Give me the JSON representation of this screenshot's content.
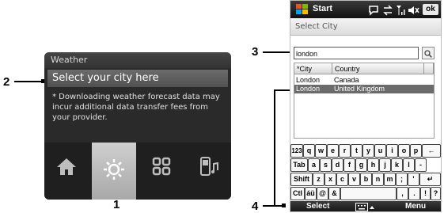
{
  "callouts": {
    "c1": "1",
    "c2": "2",
    "c3": "3",
    "c4": "4"
  },
  "weather": {
    "title": "Weather",
    "prompt": "Select your city here",
    "note": "* Downloading weather forecast data may incur additional data transfer fees from your provider.",
    "tabs": [
      {
        "icon": "home-icon",
        "selected": false
      },
      {
        "icon": "sun-icon",
        "selected": true
      },
      {
        "icon": "grid-icon",
        "selected": false
      },
      {
        "icon": "phone-music-icon",
        "selected": false
      }
    ]
  },
  "phone": {
    "status": {
      "start": "Start",
      "ok": "ok"
    },
    "page_title": "Select City",
    "search": {
      "value": "london"
    },
    "list": {
      "headers": [
        "*City",
        "Country"
      ],
      "rows": [
        {
          "city": "London",
          "country": "Canada",
          "selected": false
        },
        {
          "city": "London",
          "country": "United Kingdom",
          "selected": true
        }
      ]
    },
    "keyboard": {
      "row1": [
        "123",
        "q",
        "w",
        "e",
        "r",
        "t",
        "y",
        "u",
        "i",
        "o",
        "p",
        "←"
      ],
      "row2": [
        "Tab",
        "a",
        "s",
        "d",
        "f",
        "g",
        "h",
        "j",
        "k",
        "l",
        "-"
      ],
      "row3": [
        "Shift",
        "z",
        "x",
        "c",
        "v",
        "b",
        "n",
        "m",
        ";",
        "'",
        "↵"
      ],
      "row4": [
        "Ctl",
        "áü",
        "@",
        "&",
        "",
        ",",
        ".",
        "!",
        "?"
      ]
    },
    "softkeys": {
      "left": "Select",
      "right": "Menu"
    }
  },
  "colors": {
    "selection": "#6b6b6b",
    "weather_panel": "#2a2a2a",
    "bar_dark": "#111111"
  }
}
